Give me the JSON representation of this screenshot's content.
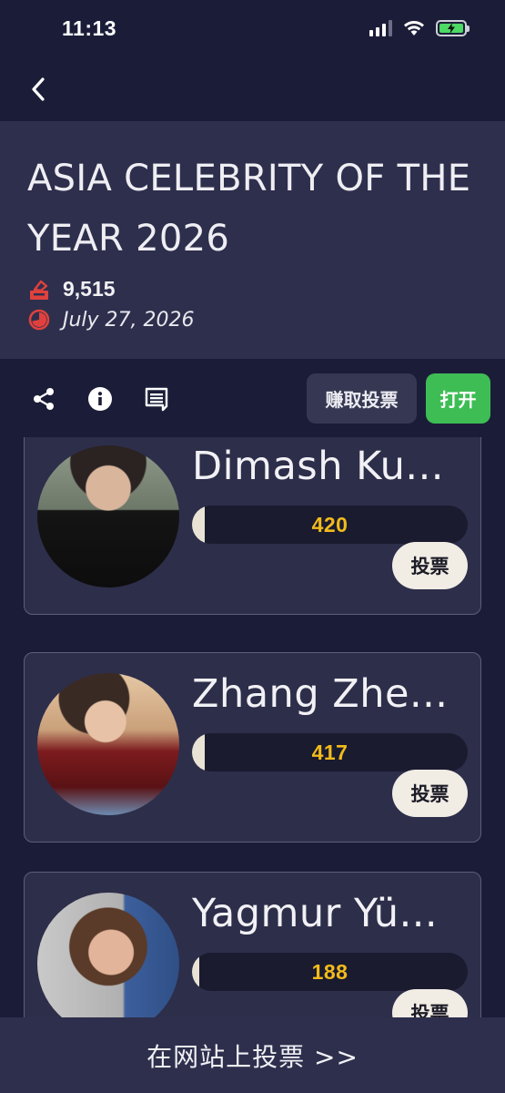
{
  "status_bar": {
    "time": "11:13"
  },
  "event": {
    "title": "ASIA CELEBRITY OF THE YEAR 2026",
    "total_votes": "9,515",
    "date": "July 27, 2026"
  },
  "toolbar": {
    "earn_votes_label": "赚取投票",
    "open_label": "打开"
  },
  "candidates": [
    {
      "name": "Dimash Ku...",
      "votes": "420",
      "vote_label": "投票"
    },
    {
      "name": "Zhang Zhe...",
      "votes": "417",
      "vote_label": "投票"
    },
    {
      "name": "Yagmur Yü...",
      "votes": "188",
      "vote_label": "投票"
    }
  ],
  "bottom_bar": {
    "label": "在网站上投票 >>"
  },
  "colors": {
    "background": "#1b1d38",
    "card": "#2e2f4d",
    "accent_green": "#3ebd55",
    "vote_count": "#f2bb1b",
    "icon_red": "#e0413d"
  }
}
